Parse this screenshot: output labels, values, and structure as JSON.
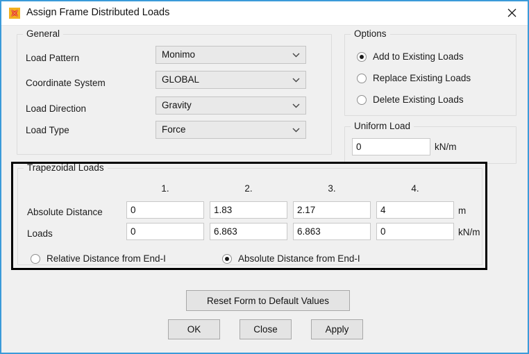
{
  "window": {
    "title": "Assign Frame Distributed Loads",
    "icon": "app-icon",
    "close_icon": "close-icon",
    "border_color": "#3a9ad9",
    "body_color": "#f0f0f0"
  },
  "general": {
    "title": "General",
    "fields": [
      {
        "label": "Load Pattern",
        "value": "Monimo"
      },
      {
        "label": "Coordinate System",
        "value": "GLOBAL"
      },
      {
        "label": "Load Direction",
        "value": "Gravity"
      },
      {
        "label": "Load Type",
        "value": "Force"
      }
    ]
  },
  "options": {
    "title": "Options",
    "items": [
      {
        "label": "Add to Existing Loads",
        "selected": true
      },
      {
        "label": "Replace Existing Loads",
        "selected": false
      },
      {
        "label": "Delete Existing Loads",
        "selected": false
      }
    ]
  },
  "uniform_load": {
    "title": "Uniform Load",
    "value": "0",
    "unit": "kN/m"
  },
  "trapezoidal": {
    "title": "Trapezoidal Loads",
    "column_headers": [
      "1.",
      "2.",
      "3.",
      "4."
    ],
    "distance_row": {
      "label": "Absolute Distance",
      "values": [
        "0",
        "1.83",
        "2.17",
        "4"
      ],
      "unit": "m"
    },
    "loads_row": {
      "label": "Loads",
      "values": [
        "0",
        "6.863",
        "6.863",
        "0"
      ],
      "unit": "kN/m"
    },
    "distance_mode": [
      {
        "label": "Relative Distance from End-I",
        "selected": false
      },
      {
        "label": "Absolute Distance from End-I",
        "selected": true
      }
    ]
  },
  "buttons": {
    "reset": "Reset Form to Default Values",
    "ok": "OK",
    "close": "Close",
    "apply": "Apply"
  }
}
